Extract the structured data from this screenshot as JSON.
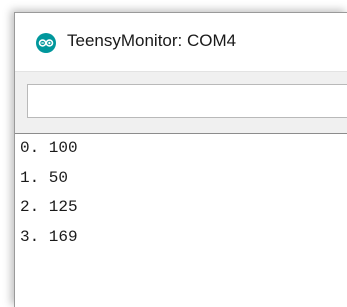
{
  "window": {
    "title": "TeensyMonitor: COM4",
    "icon": "arduino-infinity-icon"
  },
  "toolbar": {
    "send_input_value": "",
    "send_input_placeholder": ""
  },
  "output": {
    "lines": [
      "0. 100",
      "1. 50",
      "2. 125",
      "3. 169"
    ]
  },
  "colors": {
    "icon_teal": "#00979c",
    "title_bar_bg": "#ffffff",
    "toolbar_bg": "#f0f0f0"
  }
}
